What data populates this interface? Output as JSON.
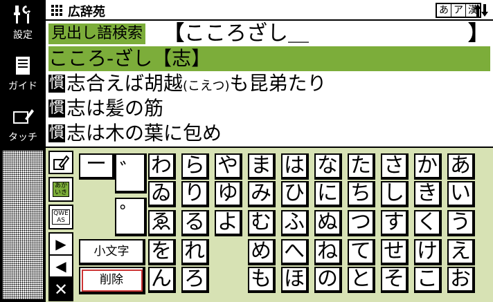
{
  "sidebar": {
    "items": [
      {
        "label": "設定",
        "icon": "settings-tools-icon"
      },
      {
        "label": "ガイド",
        "icon": "guide-book-icon"
      },
      {
        "label": "タッチ",
        "icon": "touch-pen-icon"
      }
    ]
  },
  "titlebar": {
    "app_icon": "grid-menu-icon",
    "title": "広辞苑",
    "input_modes": [
      "あ",
      "ア",
      "漢"
    ],
    "scroll_icon": "up-down-arrows-icon"
  },
  "search": {
    "label": "見出し語検索",
    "open_bracket": "【",
    "value": "こころざし＿",
    "close_bracket": "】"
  },
  "results": [
    {
      "text": "こころ‐ざし【志】",
      "selected": true
    },
    {
      "tag": "慣",
      "text": "志合えば胡越",
      "reading": "(こえつ)",
      "tail": "も昆弟たり"
    },
    {
      "tag": "慣",
      "text": "志は髪の筋"
    },
    {
      "tag": "慣",
      "text": "志は木の葉に包め"
    }
  ],
  "tools": {
    "hiragana_toggle": "あかいき",
    "qwerty_toggle": "QWEAS",
    "next_arrow": "▶",
    "prev_arrow": "◀",
    "close": "✕"
  },
  "keyboard": {
    "long_vowel": "ー",
    "dakuten": "゛",
    "handakuten": "゜",
    "small_kana": "小文字",
    "delete": "削除",
    "rows": [
      [
        "わ",
        "ら",
        "や",
        "ま",
        "は",
        "な",
        "た",
        "さ",
        "か",
        "あ"
      ],
      [
        "ゐ",
        "り",
        "ゆ",
        "み",
        "ひ",
        "に",
        "ち",
        "し",
        "き",
        "い"
      ],
      [
        "ゑ",
        "る",
        "よ",
        "む",
        "ふ",
        "ぬ",
        "つ",
        "す",
        "く",
        "う"
      ],
      [
        "を",
        "れ",
        "",
        "め",
        "へ",
        "ね",
        "て",
        "せ",
        "け",
        "え"
      ],
      [
        "ん",
        "ろ",
        "",
        "も",
        "ほ",
        "の",
        "と",
        "そ",
        "こ",
        "お"
      ]
    ]
  },
  "colors": {
    "accent": "#7cad3a",
    "keyboard_bg": "#d7e2b4"
  }
}
